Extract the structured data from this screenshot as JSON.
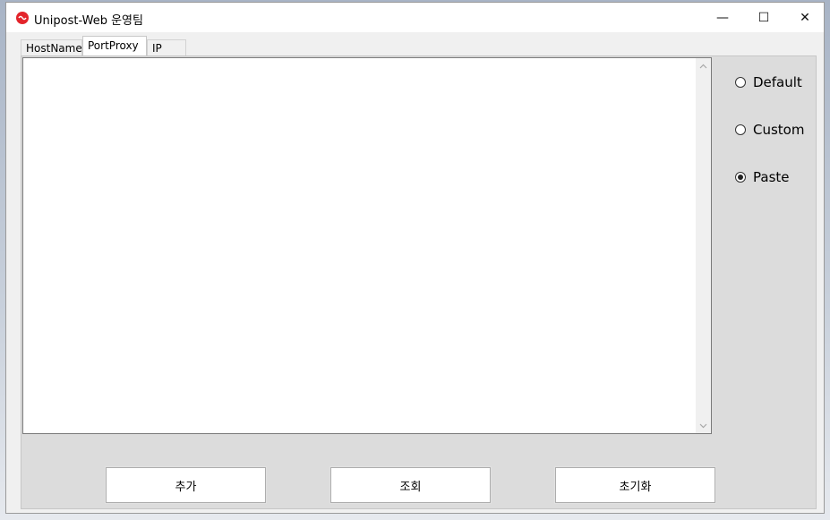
{
  "window": {
    "title": "Unipost-Web 운영팀",
    "controls": {
      "minimize": "—",
      "maximize": "☐",
      "close": "✕"
    }
  },
  "tabs": [
    {
      "label": "HostName",
      "active": false
    },
    {
      "label": "PortProxy",
      "active": true
    },
    {
      "label": "IP",
      "active": false
    }
  ],
  "content": {
    "textarea_value": ""
  },
  "radios": [
    {
      "label": "Default",
      "checked": false
    },
    {
      "label": "Custom",
      "checked": false
    },
    {
      "label": "Paste",
      "checked": true
    }
  ],
  "buttons": {
    "add": "추가",
    "query": "조회",
    "reset": "초기화"
  },
  "icons": {
    "app": "app-logo-icon",
    "scroll_up": "chevron-up-icon",
    "scroll_down": "chevron-down-icon"
  },
  "colors": {
    "app_icon": "#e3242b",
    "panel": "#dcdcdc",
    "window": "#f0f0f0"
  }
}
